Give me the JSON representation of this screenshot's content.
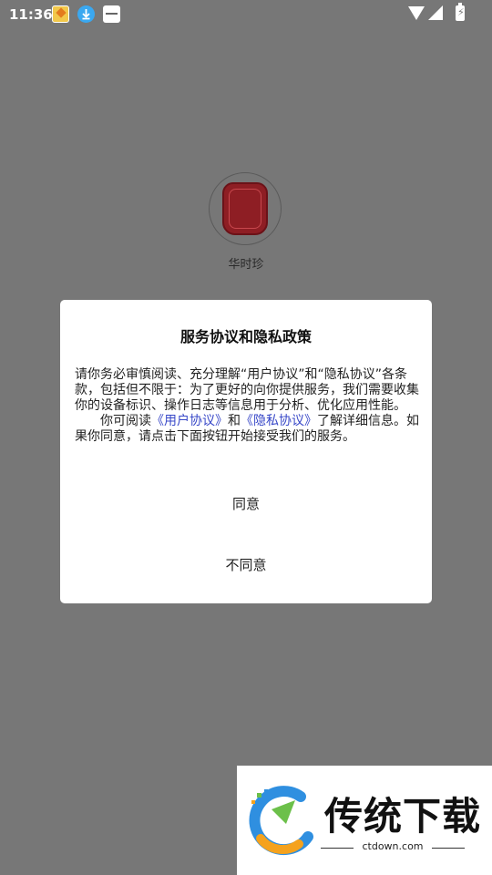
{
  "status_bar": {
    "time": "11:36",
    "battery_symbol": "⚡"
  },
  "app": {
    "name": "华时珍"
  },
  "dialog": {
    "title": "服务协议和隐私政策",
    "paragraph1": "请你务必审慎阅读、充分理解“用户协议”和“隐私协议”各条款，包括但不限于：为了更好的向你提供服务，我们需要收集你的设备标识、操作日志等信息用于分析、优化应用性能。",
    "paragraph2_prefix": "你可阅读",
    "user_agreement_link": "《用户协议》",
    "paragraph2_and": "和",
    "privacy_link": "《隐私协议》",
    "paragraph2_suffix": "了解详细信息。如果你同意，请点击下面按钮开始接受我们的服务。",
    "agree_label": "同意",
    "disagree_label": "不同意"
  },
  "watermark": {
    "brand": "传统下载",
    "url": "ctdown.com"
  },
  "colors": {
    "overlay": "#777777",
    "link": "#3848c8",
    "seal": "#8e1e24"
  }
}
